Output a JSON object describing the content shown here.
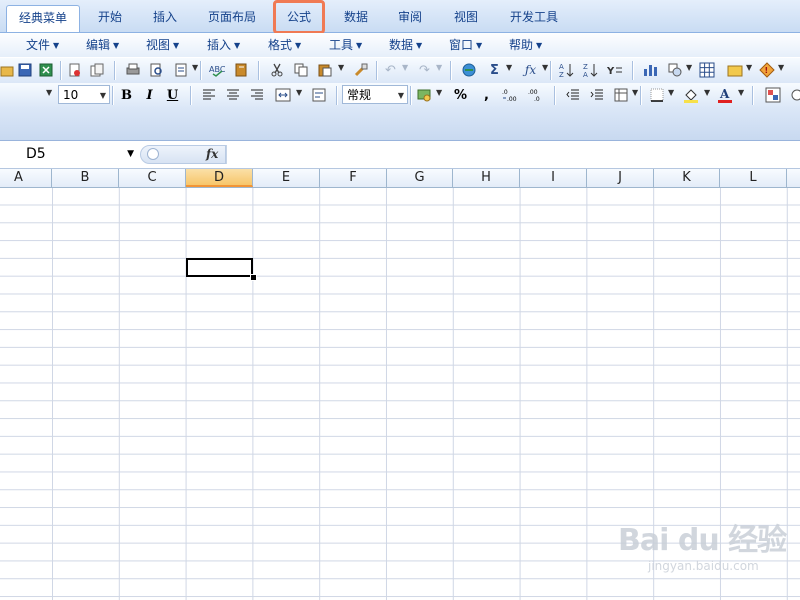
{
  "ribbon_tabs": [
    {
      "label": "经典菜单",
      "active": true
    },
    {
      "label": "开始"
    },
    {
      "label": "插入"
    },
    {
      "label": "页面布局"
    },
    {
      "label": "公式",
      "highlighted": true
    },
    {
      "label": "数据"
    },
    {
      "label": "审阅"
    },
    {
      "label": "视图"
    },
    {
      "label": "开发工具"
    }
  ],
  "menus": [
    "文件",
    "编辑",
    "视图",
    "插入",
    "格式",
    "工具",
    "数据",
    "窗口",
    "帮助"
  ],
  "toolbar": {
    "font_size": "10",
    "number_format": "常规",
    "bold_label": "B",
    "italic_label": "I",
    "underline_label": "U",
    "percent_label": "%",
    "comma_label": ",",
    "sum_label": "Σ"
  },
  "formula_bar": {
    "name_box": "D5",
    "fx_label": "fx",
    "content": ""
  },
  "columns": [
    "A",
    "B",
    "C",
    "D",
    "E",
    "F",
    "G",
    "H",
    "I",
    "J",
    "K",
    "L"
  ],
  "selected_column": "D",
  "active_cell": "D5",
  "watermark": {
    "logo_text": "Bai du 经验",
    "url_text": "jingyan.baidu.com"
  },
  "colors": {
    "highlight_outline": "#f07a54",
    "ribbon_text": "#15428b",
    "selected_header": "#f7c66a",
    "grid_line": "#d0d7e5"
  }
}
